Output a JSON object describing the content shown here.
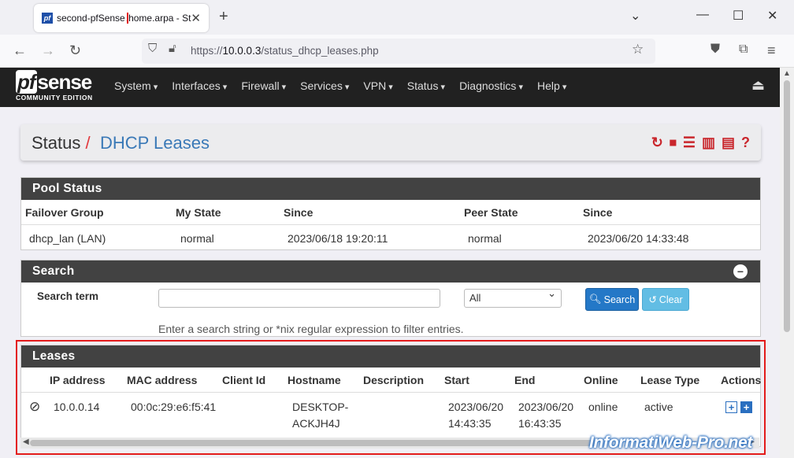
{
  "browser": {
    "tab_title_highlight": "second-pfSense",
    "tab_title_rest": ".home.arpa - St",
    "url_prefix": "https://",
    "url_host": "10.0.0.3",
    "url_path": "/status_dhcp_leases.php"
  },
  "logo": {
    "main": "pfsense",
    "sub": "COMMUNITY EDITION"
  },
  "menu": [
    "System",
    "Interfaces",
    "Firewall",
    "Services",
    "VPN",
    "Status",
    "Diagnostics",
    "Help"
  ],
  "breadcrumb": {
    "section": "Status",
    "separator": "/",
    "page": "DHCP Leases"
  },
  "pool_status": {
    "title": "Pool Status",
    "headers": [
      "Failover Group",
      "My State",
      "Since",
      "Peer State",
      "Since"
    ],
    "row": [
      "dhcp_lan (LAN)",
      "normal",
      "2023/06/18 19:20:11",
      "normal",
      "2023/06/20 14:33:48"
    ]
  },
  "search": {
    "title": "Search",
    "term_label": "Search term",
    "term_value": "",
    "filter_selected": "All",
    "search_button": "Search",
    "clear_button": "Clear",
    "help_text": "Enter a search string or *nix regular expression to filter entries."
  },
  "leases": {
    "title": "Leases",
    "headers": [
      "IP address",
      "MAC address",
      "Client Id",
      "Hostname",
      "Description",
      "Start",
      "End",
      "Online",
      "Lease Type",
      "Actions"
    ],
    "row": {
      "ip": "10.0.0.14",
      "mac": "00:0c:29:e6:f5:41",
      "client_id": "",
      "hostname_1": "DESKTOP-",
      "hostname_2": "ACKJH4J",
      "description": "",
      "start_date": "2023/06/20",
      "start_time": "14:43:35",
      "end_date": "2023/06/20",
      "end_time": "16:43:35",
      "online": "online",
      "lease_type": "active"
    }
  },
  "watermark": "InformatiWeb-Pro.net",
  "colors": {
    "accent_red": "#c9262c",
    "link_blue": "#3a79b7",
    "panel_dark": "#424242",
    "highlight_red": "#e31b1b"
  }
}
